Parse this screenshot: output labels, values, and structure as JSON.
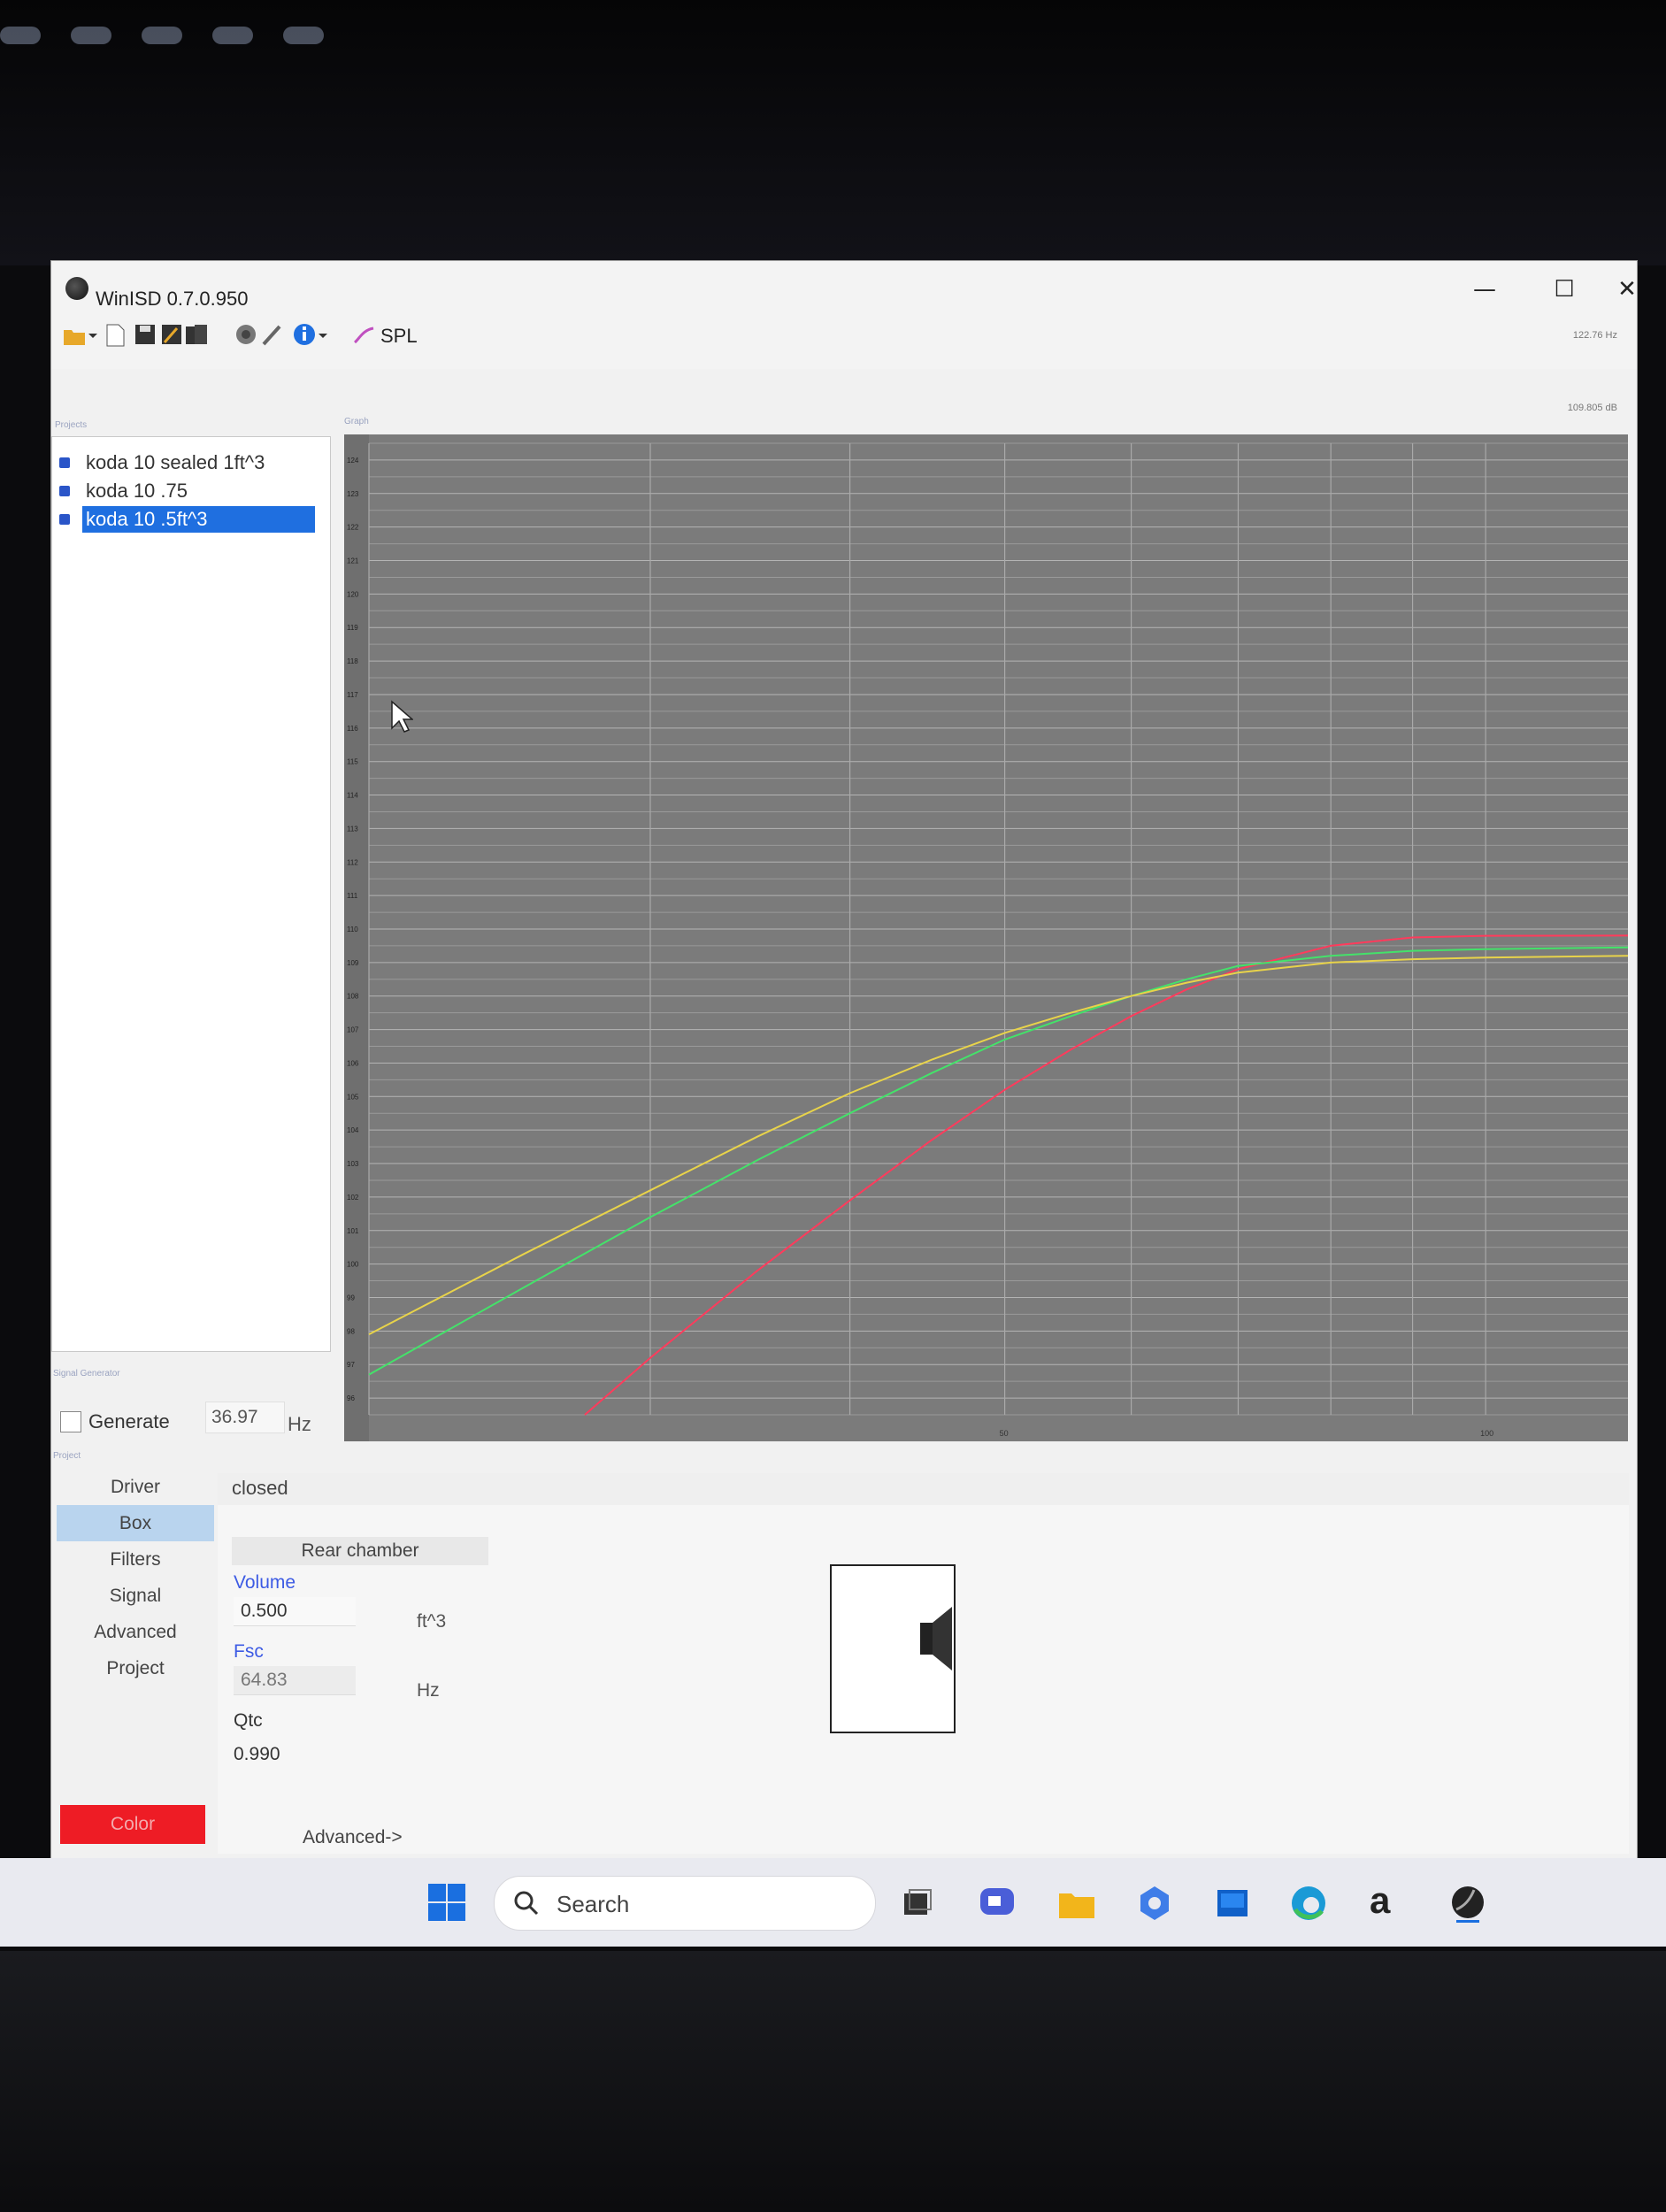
{
  "window": {
    "title": "WinISD 0.7.0.950",
    "controls": {
      "minimize": "—",
      "maximize": "☐",
      "close": "✕"
    }
  },
  "toolbar": {
    "icons": [
      "open-folder-icon",
      "new-file-icon",
      "save-icon",
      "save-as-icon",
      "save-all-icon",
      "driver-icon",
      "tools-icon",
      "info-icon"
    ],
    "spl_label": "SPL",
    "readout_freq": "122.76 Hz",
    "readout_db": "109.805 dB"
  },
  "groups": {
    "projects": "Projects",
    "graph": "Graph",
    "signal_generator": "Signal Generator",
    "project": "Project"
  },
  "projects": [
    {
      "name": "koda 10 sealed 1ft^3",
      "checked": true,
      "selected": false
    },
    {
      "name": "koda 10 .75",
      "checked": true,
      "selected": false
    },
    {
      "name": "koda 10 .5ft^3",
      "checked": true,
      "selected": true
    }
  ],
  "signal_generator": {
    "generate_label": "Generate",
    "generate_checked": false,
    "frequency": "36.97",
    "unit": "Hz"
  },
  "nav": {
    "items": [
      "Driver",
      "Box",
      "Filters",
      "Signal",
      "Advanced",
      "Project"
    ],
    "active": "Box",
    "color_label": "Color",
    "color": "#ee1c25"
  },
  "box_panel": {
    "type": "closed",
    "rear_chamber_label": "Rear chamber",
    "volume_label": "Volume",
    "volume_value": "0.500",
    "volume_unit": "ft^3",
    "fsc_label": "Fsc",
    "fsc_value": "64.83",
    "fsc_unit": "Hz",
    "qtc_label": "Qtc",
    "qtc_value": "0.990",
    "advanced_label": "Advanced->"
  },
  "taskbar": {
    "search_placeholder": "Search",
    "icons": [
      "windows-start-icon",
      "task-view-icon",
      "chat-icon",
      "file-explorer-icon",
      "copilot-icon",
      "store-icon",
      "edge-icon",
      "amazon-icon",
      "winisd-icon"
    ]
  },
  "chart_data": {
    "type": "line",
    "title": "",
    "xlabel": "",
    "ylabel": "",
    "x_scale": "log",
    "xlim": [
      20,
      122.76
    ],
    "ylim": [
      95.5,
      124.5
    ],
    "x_tick_labels": [
      50,
      100
    ],
    "y_step": 0.5,
    "grid": true,
    "series": [
      {
        "color": "#ff3b5c",
        "x": [
          27.3,
          30,
          35,
          40,
          45,
          50,
          55,
          60,
          65,
          70,
          80,
          90,
          100,
          122.76
        ],
        "y": [
          95.5,
          97.2,
          99.8,
          101.9,
          103.7,
          105.2,
          106.4,
          107.4,
          108.2,
          108.8,
          109.5,
          109.75,
          109.8,
          109.805
        ]
      },
      {
        "color": "#44e26a",
        "x": [
          20,
          25,
          30,
          35,
          40,
          45,
          50,
          55,
          60,
          65,
          70,
          80,
          90,
          100,
          122.76
        ],
        "y": [
          96.7,
          99.3,
          101.4,
          103.1,
          104.5,
          105.7,
          106.7,
          107.4,
          108.0,
          108.5,
          108.9,
          109.2,
          109.35,
          109.4,
          109.45
        ]
      },
      {
        "color": "#e8d34a",
        "x": [
          20,
          25,
          30,
          35,
          40,
          45,
          50,
          55,
          60,
          65,
          70,
          80,
          90,
          100,
          122.76
        ],
        "y": [
          97.9,
          100.3,
          102.2,
          103.8,
          105.1,
          106.1,
          106.9,
          107.5,
          108.0,
          108.4,
          108.7,
          109.0,
          109.1,
          109.15,
          109.2
        ]
      }
    ]
  }
}
